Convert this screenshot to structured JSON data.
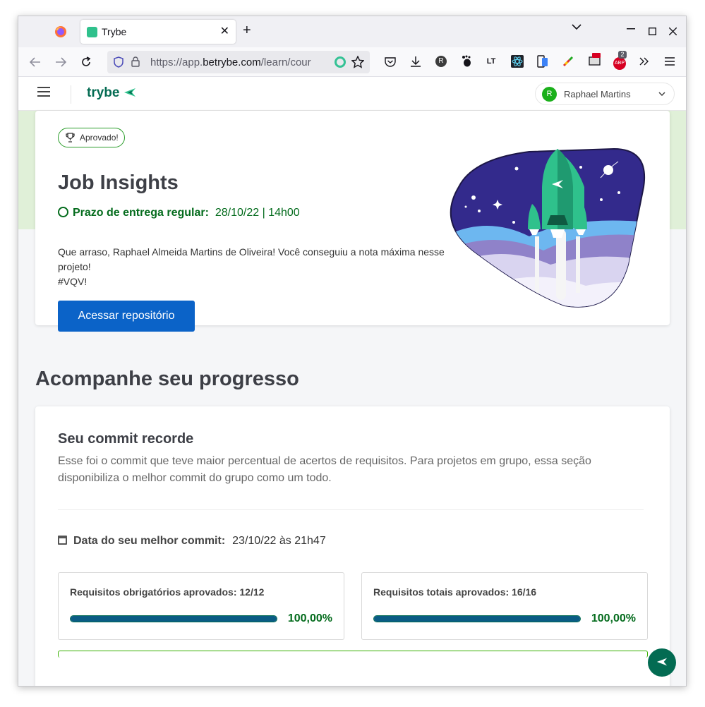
{
  "browser": {
    "tab_title": "Trybe",
    "tab_close": "✕",
    "new_tab": "+",
    "url_prefix": "https://app.",
    "url_domain": "betrybe.com",
    "url_path": "/learn/cour",
    "ext_badge_count": "2",
    "ext_adblock_label": "ABP",
    "ext_lt_label": "LT",
    "ext_r_label": "R"
  },
  "header": {
    "logo_text": "trybe",
    "user_initial": "R",
    "user_name": "Raphael Martins"
  },
  "project": {
    "badge": "Aprovado!",
    "title": "Job Insights",
    "deadline_label": "Prazo de entrega regular:",
    "deadline_value": "28/10/22 | 14h00",
    "message_line1": "Que arraso, Raphael Almeida Martins de Oliveira! Você conseguiu a nota máxima nesse projeto!",
    "message_line2": "#VQV!",
    "repo_button": "Acessar repositório"
  },
  "progress": {
    "section_title": "Acompanhe seu progresso",
    "card_title": "Seu commit recorde",
    "card_desc": "Esse foi o commit que teve maior percentual de acertos de requisitos. Para projetos em grupo, essa seção disponibiliza o melhor commit do grupo como um todo.",
    "best_commit_label": "Data do seu melhor commit:",
    "best_commit_value": "23/10/22 às 21h47",
    "requirements": [
      {
        "label": "Requisitos obrigatórios aprovados: 12/12",
        "percent_text": "100,00%",
        "fraction": 1.0
      },
      {
        "label": "Requisitos totais aprovados: 16/16",
        "percent_text": "100,00%",
        "fraction": 1.0
      }
    ]
  },
  "colors": {
    "brand_green": "#036b52",
    "accent_green": "#2fc18c",
    "button_blue": "#0b63c8",
    "bar_fill": "#0a5c84"
  }
}
